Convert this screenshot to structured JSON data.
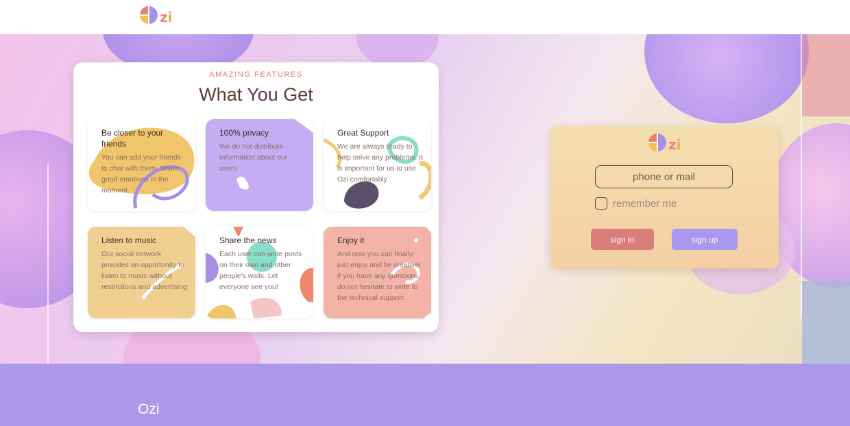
{
  "header": {
    "logo": {
      "letters": "zi",
      "icon": "quartered-circle-logo-icon"
    }
  },
  "features": {
    "eyebrow": "AMAZING FEATURES",
    "title": "What You Get",
    "items": [
      {
        "title": "Be closer to your friends",
        "text": "You can add your friends to chat with them. Share good emotions in the moment.",
        "color": "#f0c26a"
      },
      {
        "title": "100% privacy",
        "text": "We do not distribute information about our users",
        "color": "#c4adf3"
      },
      {
        "title": "Great Support",
        "text": "We are always ready to help solve any problems. It is important for us to use Ozi comfortably",
        "color": "#ffffff"
      },
      {
        "title": "Listen to music",
        "text": "Our social network provides an opportunity to listen to music without restrictions and advertising",
        "color": "#f0cf91"
      },
      {
        "title": "Share the news",
        "text": "Each user can write posts on their own and other people's walls. Let everyone see you!",
        "color": "#ffffff"
      },
      {
        "title": "Enjoy it",
        "text": "And now you can finally; just enjoy and be creative! if you have any questions, do not hesitate to write to the technical support",
        "color": "#f3b3a8"
      }
    ]
  },
  "login": {
    "logo": {
      "letters": "zi",
      "icon": "quartered-circle-logo-icon"
    },
    "login_placeholder": "phone or mail",
    "remember_label": "remember me",
    "signin_label": "sign in",
    "signup_label": "sign up",
    "signin_color": "#d97c7a",
    "signup_color": "#a998ef"
  },
  "footer": {
    "brand": "Ozi",
    "background": "#ab98e8"
  }
}
